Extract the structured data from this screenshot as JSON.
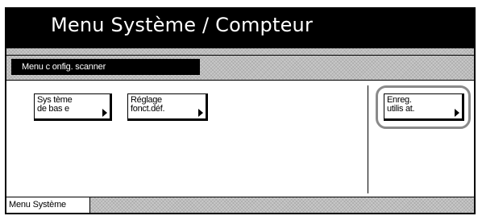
{
  "header": {
    "title": "Menu Système / Compteur"
  },
  "tab": {
    "label": "Menu c onfig. scanner"
  },
  "buttons": {
    "system_basic": "Sys tème\nde bas e",
    "default_settings": "Réglage\nfonct.déf.",
    "register_user": "Enreg.\nutilis at."
  },
  "status_bar": {
    "label": "Menu Système"
  },
  "colors": {
    "title_bg": "#000000",
    "highlight_ring": "#8a8a8a",
    "band_pattern": "#c9c9c9"
  }
}
